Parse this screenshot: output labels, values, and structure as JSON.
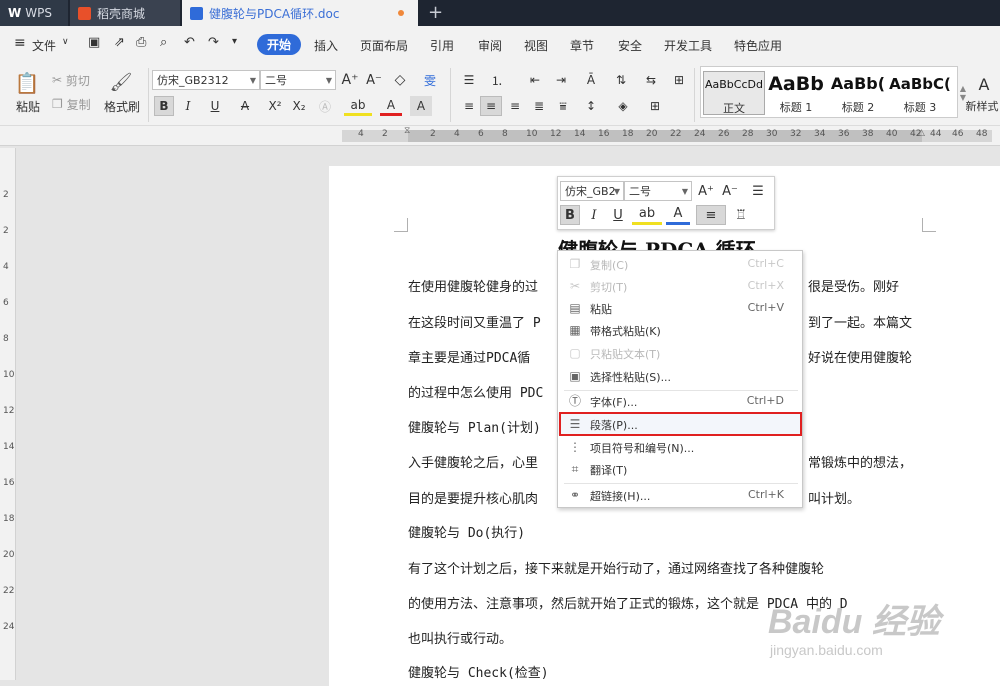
{
  "tabs": {
    "app": "WPS",
    "shell": "稻壳商城",
    "doc": "健腹轮与PDCA循环.doc",
    "new_tab": "+"
  },
  "menu": {
    "file": "文件",
    "items": [
      "开始",
      "插入",
      "页面布局",
      "引用",
      "审阅",
      "视图",
      "章节",
      "安全",
      "开发工具",
      "特色应用"
    ]
  },
  "ribbon": {
    "paste": "粘贴",
    "cut": "剪切",
    "copy": "复制",
    "format_painter": "格式刷",
    "font_name": "仿宋_GB2312",
    "font_size": "二号",
    "styles": [
      {
        "preview": "AaBbCcDd",
        "label": "正文"
      },
      {
        "preview": "AaBb",
        "label": "标题 1"
      },
      {
        "preview": "AaBb(",
        "label": "标题 2"
      },
      {
        "preview": "AaBbC(",
        "label": "标题 3"
      }
    ],
    "new_style": "新样式"
  },
  "ruler": {
    "h_ticks": [
      "4",
      "2",
      "2",
      "4",
      "6",
      "8",
      "10",
      "12",
      "14",
      "16",
      "18",
      "20",
      "22",
      "24",
      "26",
      "28",
      "30",
      "32",
      "34",
      "36",
      "38",
      "40",
      "42",
      "44",
      "46",
      "48"
    ],
    "v_ticks": [
      "2",
      "2",
      "4",
      "6",
      "8",
      "10",
      "12",
      "14",
      "16",
      "18",
      "20",
      "22",
      "24"
    ]
  },
  "float_toolbar": {
    "font": "仿宋_GB2",
    "size": "二号"
  },
  "document": {
    "title": "健腹轮与 PDCA 循环",
    "lines": [
      "在使用健腹轮健身的过",
      "很是受伤。刚好",
      "在这段时间又重温了 P",
      "到了一起。本篇文",
      "章主要是通过PDCA循",
      "好说在使用健腹轮",
      "的过程中怎么使用 PDC",
      "健腹轮与 Plan(计划)",
      "入手健腹轮之后，心里",
      "常锻炼中的想法，",
      "目的是要提升核心肌肉",
      "叫计划。",
      "健腹轮与 Do(执行)",
      "有了这个计划之后，接下来就是开始行动了，通过网络查找了各种健腹轮",
      "的使用方法、注意事项，然后就开始了正式的锻炼，这个就是 PDCA 中的 D",
      "也叫执行或行动。",
      "健腹轮与 Check(检查)"
    ]
  },
  "context_menu": {
    "items": [
      {
        "label": "复制(C)",
        "shortcut": "Ctrl+C",
        "icon": "copy-icon",
        "disabled": true
      },
      {
        "label": "剪切(T)",
        "shortcut": "Ctrl+X",
        "icon": "cut-icon",
        "disabled": true
      },
      {
        "label": "粘贴",
        "shortcut": "Ctrl+V",
        "icon": "paste-icon",
        "disabled": false
      },
      {
        "label": "带格式粘贴(K)",
        "shortcut": "",
        "icon": "paste-format-icon",
        "disabled": false
      },
      {
        "label": "只粘贴文本(T)",
        "shortcut": "",
        "icon": "paste-text-icon",
        "disabled": true
      },
      {
        "label": "选择性粘贴(S)...",
        "shortcut": "",
        "icon": "paste-special-icon",
        "disabled": false
      },
      {
        "label": "字体(F)...",
        "shortcut": "Ctrl+D",
        "icon": "font-icon",
        "disabled": false
      },
      {
        "label": "段落(P)...",
        "shortcut": "",
        "icon": "paragraph-icon",
        "disabled": false
      },
      {
        "label": "项目符号和编号(N)...",
        "shortcut": "",
        "icon": "bullets-icon",
        "disabled": false
      },
      {
        "label": "翻译(T)",
        "shortcut": "",
        "icon": "translate-icon",
        "disabled": false
      },
      {
        "label": "超链接(H)...",
        "shortcut": "Ctrl+K",
        "icon": "hyperlink-icon",
        "disabled": false
      }
    ]
  },
  "watermark": {
    "brand": "Baidu 经验",
    "url": "jingyan.baidu.com"
  },
  "colors": {
    "accent": "#2f6bd9",
    "highlight": "#e02020",
    "tabbar": "#1e2531"
  }
}
